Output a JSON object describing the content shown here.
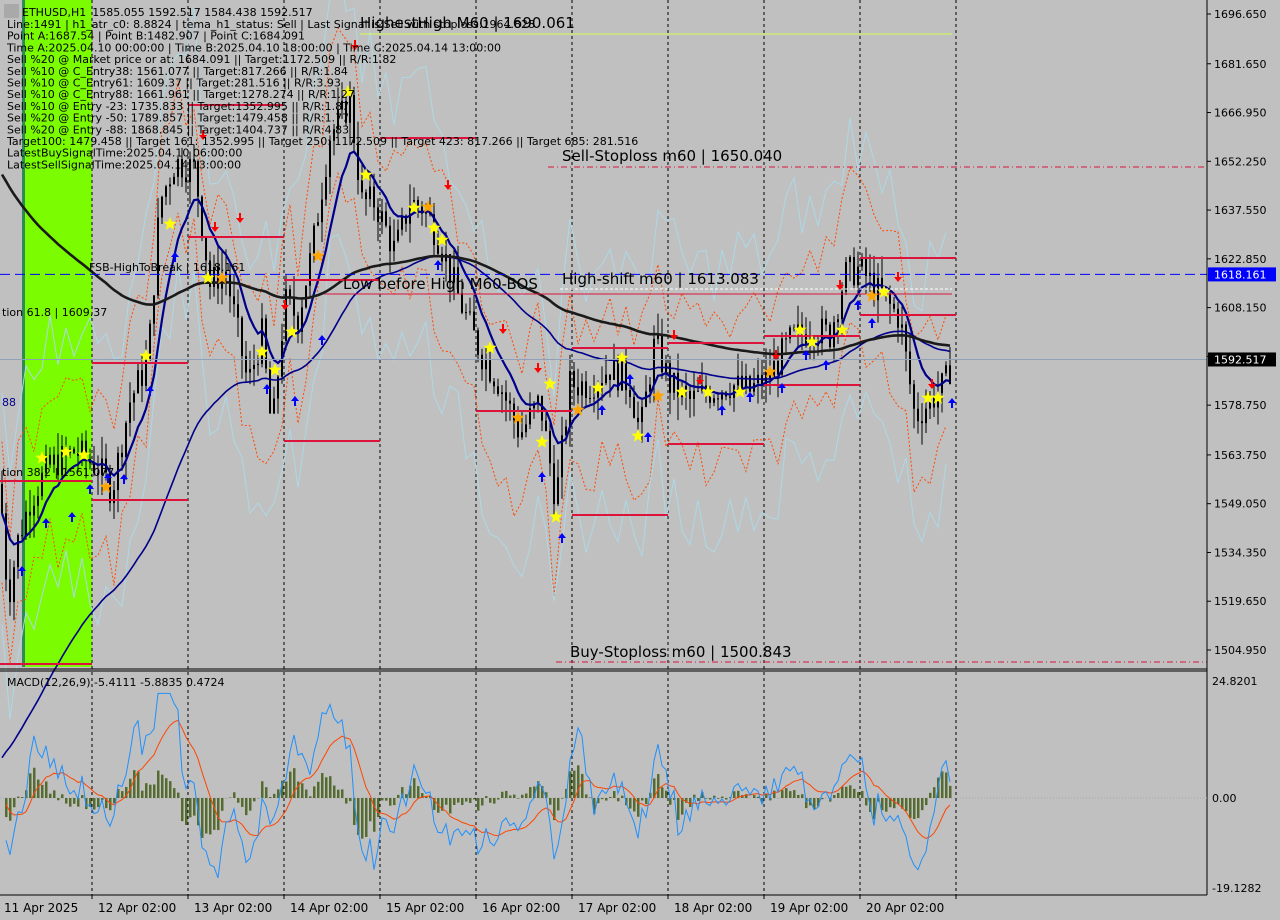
{
  "colors": {
    "background": "#c0c0c0",
    "candle": "#000000",
    "ema_fast": "#00008b",
    "ema_slow": "#1a1a1a",
    "band": "#ff4a00",
    "band_light": "#add8e6",
    "level_red": "#dc143c",
    "hline_blue": "#0000ff",
    "green_zone": "#7cfc00",
    "macd_hist": "#556b2f",
    "macd_signal": "#ff4500",
    "macd_line": "#1e90ff",
    "buy_arrow": "#0000ff",
    "sell_arrow": "#ff0000",
    "star": "#ffff00",
    "price_label_bg": "#000000",
    "blue_label_bg": "#0000ff"
  },
  "header": {
    "symbol": "ETHUSD,H1",
    "ohlc": "1585.055 1592.517 1584.438 1592.517"
  },
  "info_lines": [
    "Line:1491 | h1_atr_c0: 8.8824 | tema_h1_status: Sell | Last Signal is:Sell with stoploss:1964.828",
    "Point A:1687.54 | Point B:1482.907 | Point C:1684.091",
    "Time A:2025.04.10 00:00:00 | Time B:2025.04.10 18:00:00 | Time C:2025.04.14 13:00:00",
    "Sell %20 @ Market price or at: 1684.091 || Target:1172.509 || R/R:1.82",
    "Sell %10 @ C_Entry38: 1561.077 || Target:817.266 || R/R:1.84",
    "Sell %10 @ C_Entry61: 1609.37 || Target:281.516 || R/R:3.93",
    "Sell %10 @ C_Entry88: 1661.961 || Target:1278.274 || R/R:1.27",
    "Sell %10 @ Entry -23: 1735.833 || Target:1352.995 || R/R:1.87",
    "Sell %20 @ Entry -50: 1789.857 || Target:1479.458 || R/R:1.77",
    "Sell %20 @ Entry -88: 1868.845 || Target:1404.737 || R/R:4.83",
    "Target100: 1479.458 || Target 161: 1352.995 || Target 250: 1172.509 || Target 423: 817.266 || Target 685: 281.516",
    "LatestBuySignalTime:2025.04.10 06:00:00",
    "LatestSellSignalTime:2025.04.14 13:00:00"
  ],
  "annotations": {
    "highest_high": "HighestHigh   M60 | 1690.061",
    "sell_stoploss": "Sell-Stoploss m60 | 1650.040",
    "fsb_high": "FSB-HighToBreak | 1618.161",
    "low_before_high": "Low before High   M60-BOS",
    "high_shift": "High-shift m60 | 1613.083",
    "fib_61": "tion 61.8 | 1609.37",
    "fib_38": "tion 38.2 | 1561.077",
    "left_88": "88",
    "buy_stoploss": "Buy-Stoploss m60 | 1500.843"
  },
  "price_axis": {
    "ticks": [
      "1696.650",
      "1681.650",
      "1666.950",
      "1652.250",
      "1637.550",
      "1622.850",
      "1608.150",
      "1593.450",
      "1578.750",
      "1563.750",
      "1549.050",
      "1534.350",
      "1519.650",
      "1504.950"
    ],
    "tick_values": [
      1696.65,
      1681.65,
      1666.95,
      1652.25,
      1637.55,
      1622.85,
      1608.15,
      1593.45,
      1578.75,
      1563.75,
      1549.05,
      1534.35,
      1519.65,
      1504.95
    ],
    "current_price": "1592.517",
    "current_price_value": 1592.517,
    "blue_level": "1618.161",
    "blue_level_value": 1618.161
  },
  "macd": {
    "title": "MACD(12,26,9) -5.4111 -5.8835 0.4724",
    "ticks": [
      "24.8201",
      "0.00",
      "-19.1282"
    ],
    "max": 24.8201,
    "min": -19.1282
  },
  "time_axis": {
    "labels": [
      "11 Apr 2025",
      "12 Apr 02:00",
      "13 Apr 02:00",
      "14 Apr 02:00",
      "15 Apr 02:00",
      "16 Apr 02:00",
      "17 Apr 02:00",
      "18 Apr 02:00",
      "19 Apr 02:00",
      "20 Apr 02:00"
    ]
  },
  "chart_data": {
    "type": "candlestick",
    "symbol": "ETHUSD",
    "timeframe": "H1",
    "ylim": [
      1498,
      1700
    ],
    "price_path_anchors": [
      {
        "x": 0,
        "y": 1555
      },
      {
        "x": 8,
        "y": 1520
      },
      {
        "x": 18,
        "y": 1538
      },
      {
        "x": 30,
        "y": 1550
      },
      {
        "x": 48,
        "y": 1560
      },
      {
        "x": 75,
        "y": 1565
      },
      {
        "x": 98,
        "y": 1560
      },
      {
        "x": 112,
        "y": 1553
      },
      {
        "x": 130,
        "y": 1580
      },
      {
        "x": 148,
        "y": 1592
      },
      {
        "x": 160,
        "y": 1640
      },
      {
        "x": 175,
        "y": 1652
      },
      {
        "x": 195,
        "y": 1650
      },
      {
        "x": 210,
        "y": 1615
      },
      {
        "x": 225,
        "y": 1620
      },
      {
        "x": 248,
        "y": 1585
      },
      {
        "x": 262,
        "y": 1600
      },
      {
        "x": 272,
        "y": 1570
      },
      {
        "x": 285,
        "y": 1610
      },
      {
        "x": 298,
        "y": 1605
      },
      {
        "x": 312,
        "y": 1625
      },
      {
        "x": 330,
        "y": 1660
      },
      {
        "x": 350,
        "y": 1670
      },
      {
        "x": 362,
        "y": 1640
      },
      {
        "x": 375,
        "y": 1640
      },
      {
        "x": 395,
        "y": 1625
      },
      {
        "x": 410,
        "y": 1640
      },
      {
        "x": 425,
        "y": 1638
      },
      {
        "x": 440,
        "y": 1628
      },
      {
        "x": 460,
        "y": 1610
      },
      {
        "x": 480,
        "y": 1595
      },
      {
        "x": 500,
        "y": 1585
      },
      {
        "x": 520,
        "y": 1570
      },
      {
        "x": 540,
        "y": 1580
      },
      {
        "x": 556,
        "y": 1550
      },
      {
        "x": 570,
        "y": 1585
      },
      {
        "x": 590,
        "y": 1585
      },
      {
        "x": 610,
        "y": 1590
      },
      {
        "x": 630,
        "y": 1585
      },
      {
        "x": 640,
        "y": 1570
      },
      {
        "x": 655,
        "y": 1598
      },
      {
        "x": 670,
        "y": 1585
      },
      {
        "x": 690,
        "y": 1580
      },
      {
        "x": 710,
        "y": 1583
      },
      {
        "x": 730,
        "y": 1585
      },
      {
        "x": 750,
        "y": 1583
      },
      {
        "x": 770,
        "y": 1588
      },
      {
        "x": 790,
        "y": 1598
      },
      {
        "x": 810,
        "y": 1602
      },
      {
        "x": 830,
        "y": 1600
      },
      {
        "x": 845,
        "y": 1618
      },
      {
        "x": 860,
        "y": 1620
      },
      {
        "x": 880,
        "y": 1612
      },
      {
        "x": 900,
        "y": 1605
      },
      {
        "x": 915,
        "y": 1575
      },
      {
        "x": 930,
        "y": 1580
      },
      {
        "x": 945,
        "y": 1585
      },
      {
        "x": 952,
        "y": 1592
      }
    ]
  }
}
